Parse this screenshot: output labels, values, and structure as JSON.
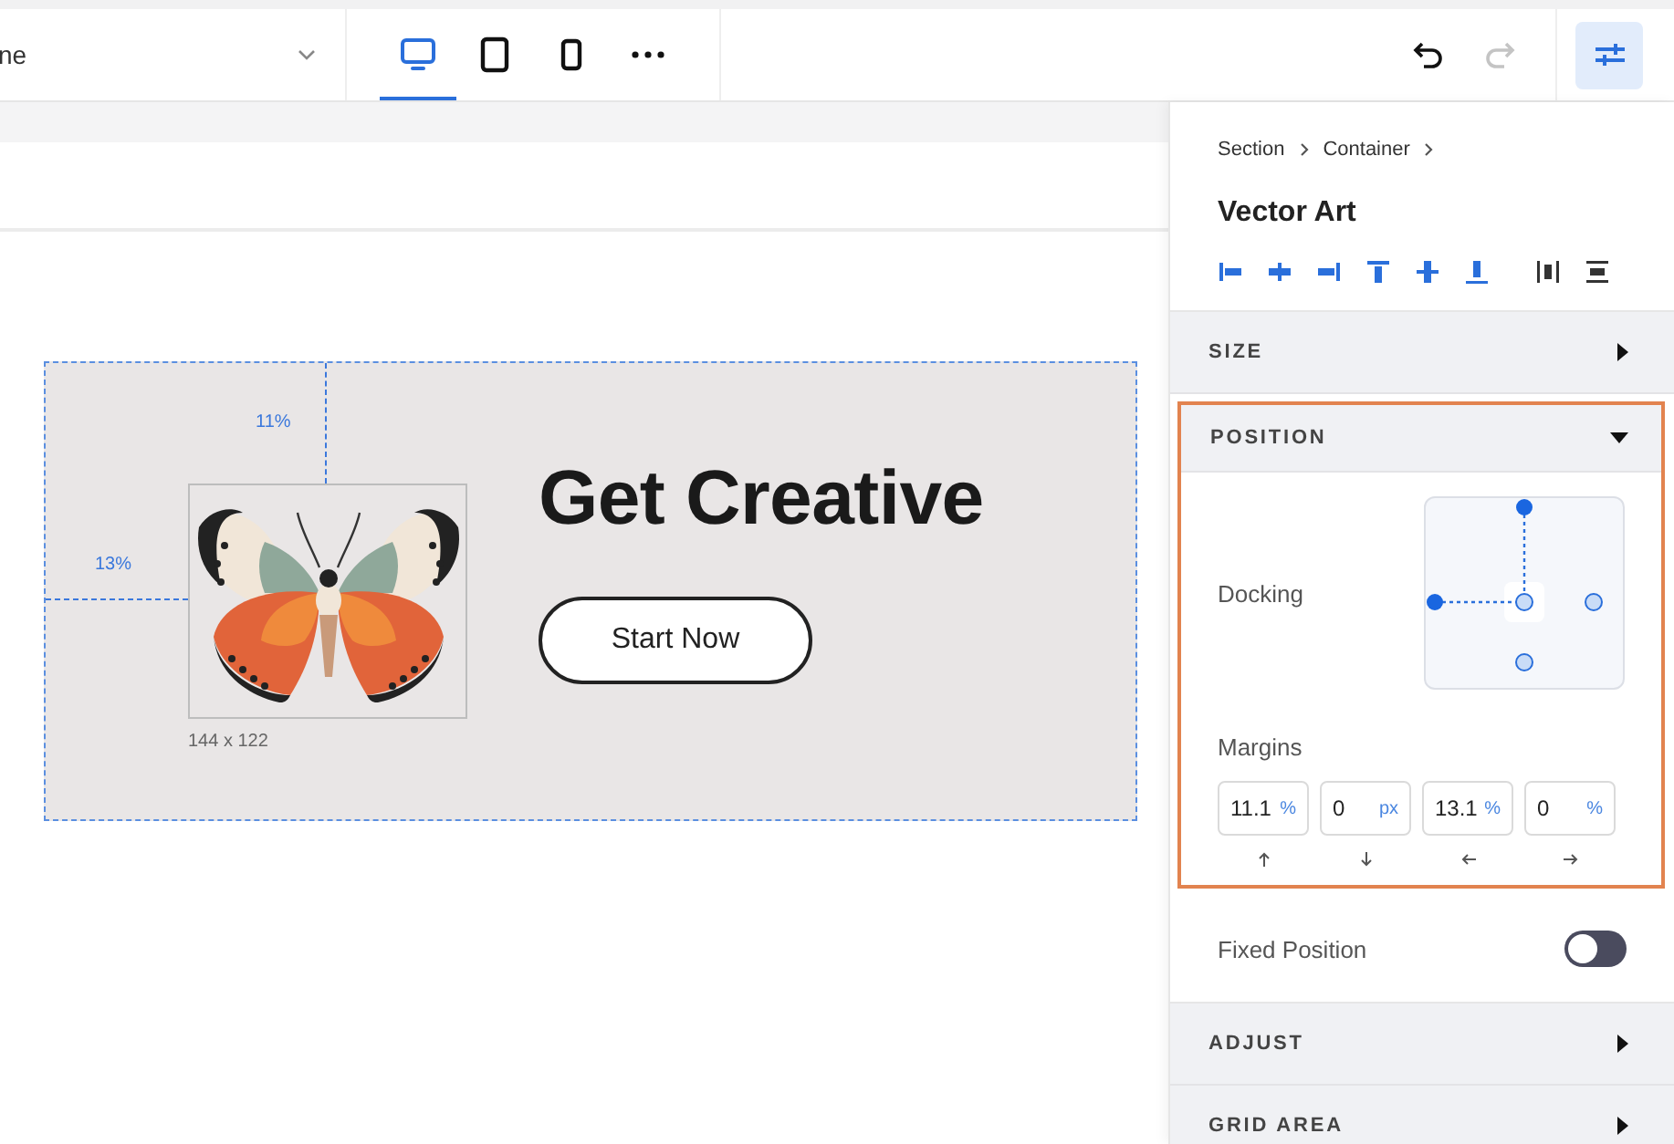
{
  "toolbar": {
    "page_select": {
      "value": "ne"
    },
    "devices": [
      {
        "kind": "desktop",
        "selected": true
      },
      {
        "kind": "tablet",
        "selected": false
      },
      {
        "kind": "mobile",
        "selected": false
      },
      {
        "kind": "more",
        "selected": false
      }
    ],
    "history": [
      {
        "kind": "undo",
        "disabled": false
      },
      {
        "kind": "redo",
        "disabled": true
      }
    ],
    "settings": {
      "selected": true
    }
  },
  "canvas": {
    "guides": [
      {
        "kind": "top",
        "label": "11%"
      },
      {
        "kind": "left",
        "label": "13%"
      }
    ],
    "image": {
      "size_label": "144 x 122"
    },
    "heading": "Get Creative",
    "button": "Start Now"
  },
  "panel": {
    "breadcrumb": [
      "Section",
      "Container"
    ],
    "title": "Vector Art",
    "sections": [
      {
        "kind": "header",
        "label": "SIZE",
        "expanded": false
      },
      {
        "kind": "position",
        "label": "POSITION",
        "expanded": true,
        "docking_label": "Docking",
        "anchors": [
          {
            "kind": "top",
            "selected": true
          },
          {
            "kind": "left",
            "selected": true
          },
          {
            "kind": "right",
            "selected": false
          },
          {
            "kind": "bottom",
            "selected": false
          }
        ],
        "margins_label": "Margins",
        "margins": [
          {
            "value": "11.1",
            "unit": "%",
            "kind": "up"
          },
          {
            "value": "0",
            "unit": "px",
            "kind": "down"
          },
          {
            "value": "13.1",
            "unit": "%",
            "kind": "left"
          },
          {
            "value": "0",
            "unit": "%",
            "kind": "right"
          }
        ]
      },
      {
        "kind": "toggle",
        "label": "Fixed Position",
        "on": false
      },
      {
        "kind": "header",
        "label": "ADJUST",
        "expanded": false
      },
      {
        "kind": "header",
        "label": "GRID AREA",
        "expanded": false
      }
    ]
  }
}
